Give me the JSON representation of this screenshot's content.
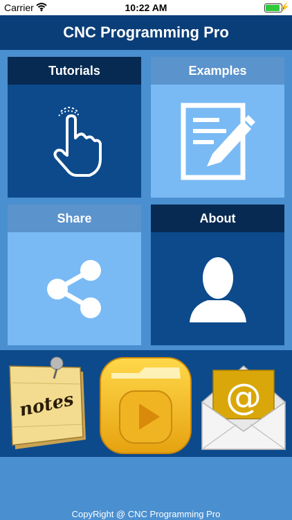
{
  "status_bar": {
    "carrier": "Carrier",
    "time": "10:22 AM"
  },
  "nav": {
    "title": "CNC Programming Pro"
  },
  "tiles": [
    {
      "label": "Tutorials",
      "icon": "touch-hand-icon"
    },
    {
      "label": "Examples",
      "icon": "document-edit-icon"
    },
    {
      "label": "Share",
      "icon": "share-icon"
    },
    {
      "label": "About",
      "icon": "person-silhouette-icon"
    }
  ],
  "apps": {
    "notes_text": "notes",
    "notes_icon": "notes-icon",
    "video_icon": "video-folder-icon",
    "mail_icon": "mail-icon"
  },
  "footer": {
    "copyright": "CopyRight @ CNC Programming Pro"
  },
  "colors": {
    "nav_bg": "#0a3e78",
    "page_bg": "#4a8fd0",
    "tile_dark": "#0c4a8c",
    "tile_light": "#79baf5"
  }
}
